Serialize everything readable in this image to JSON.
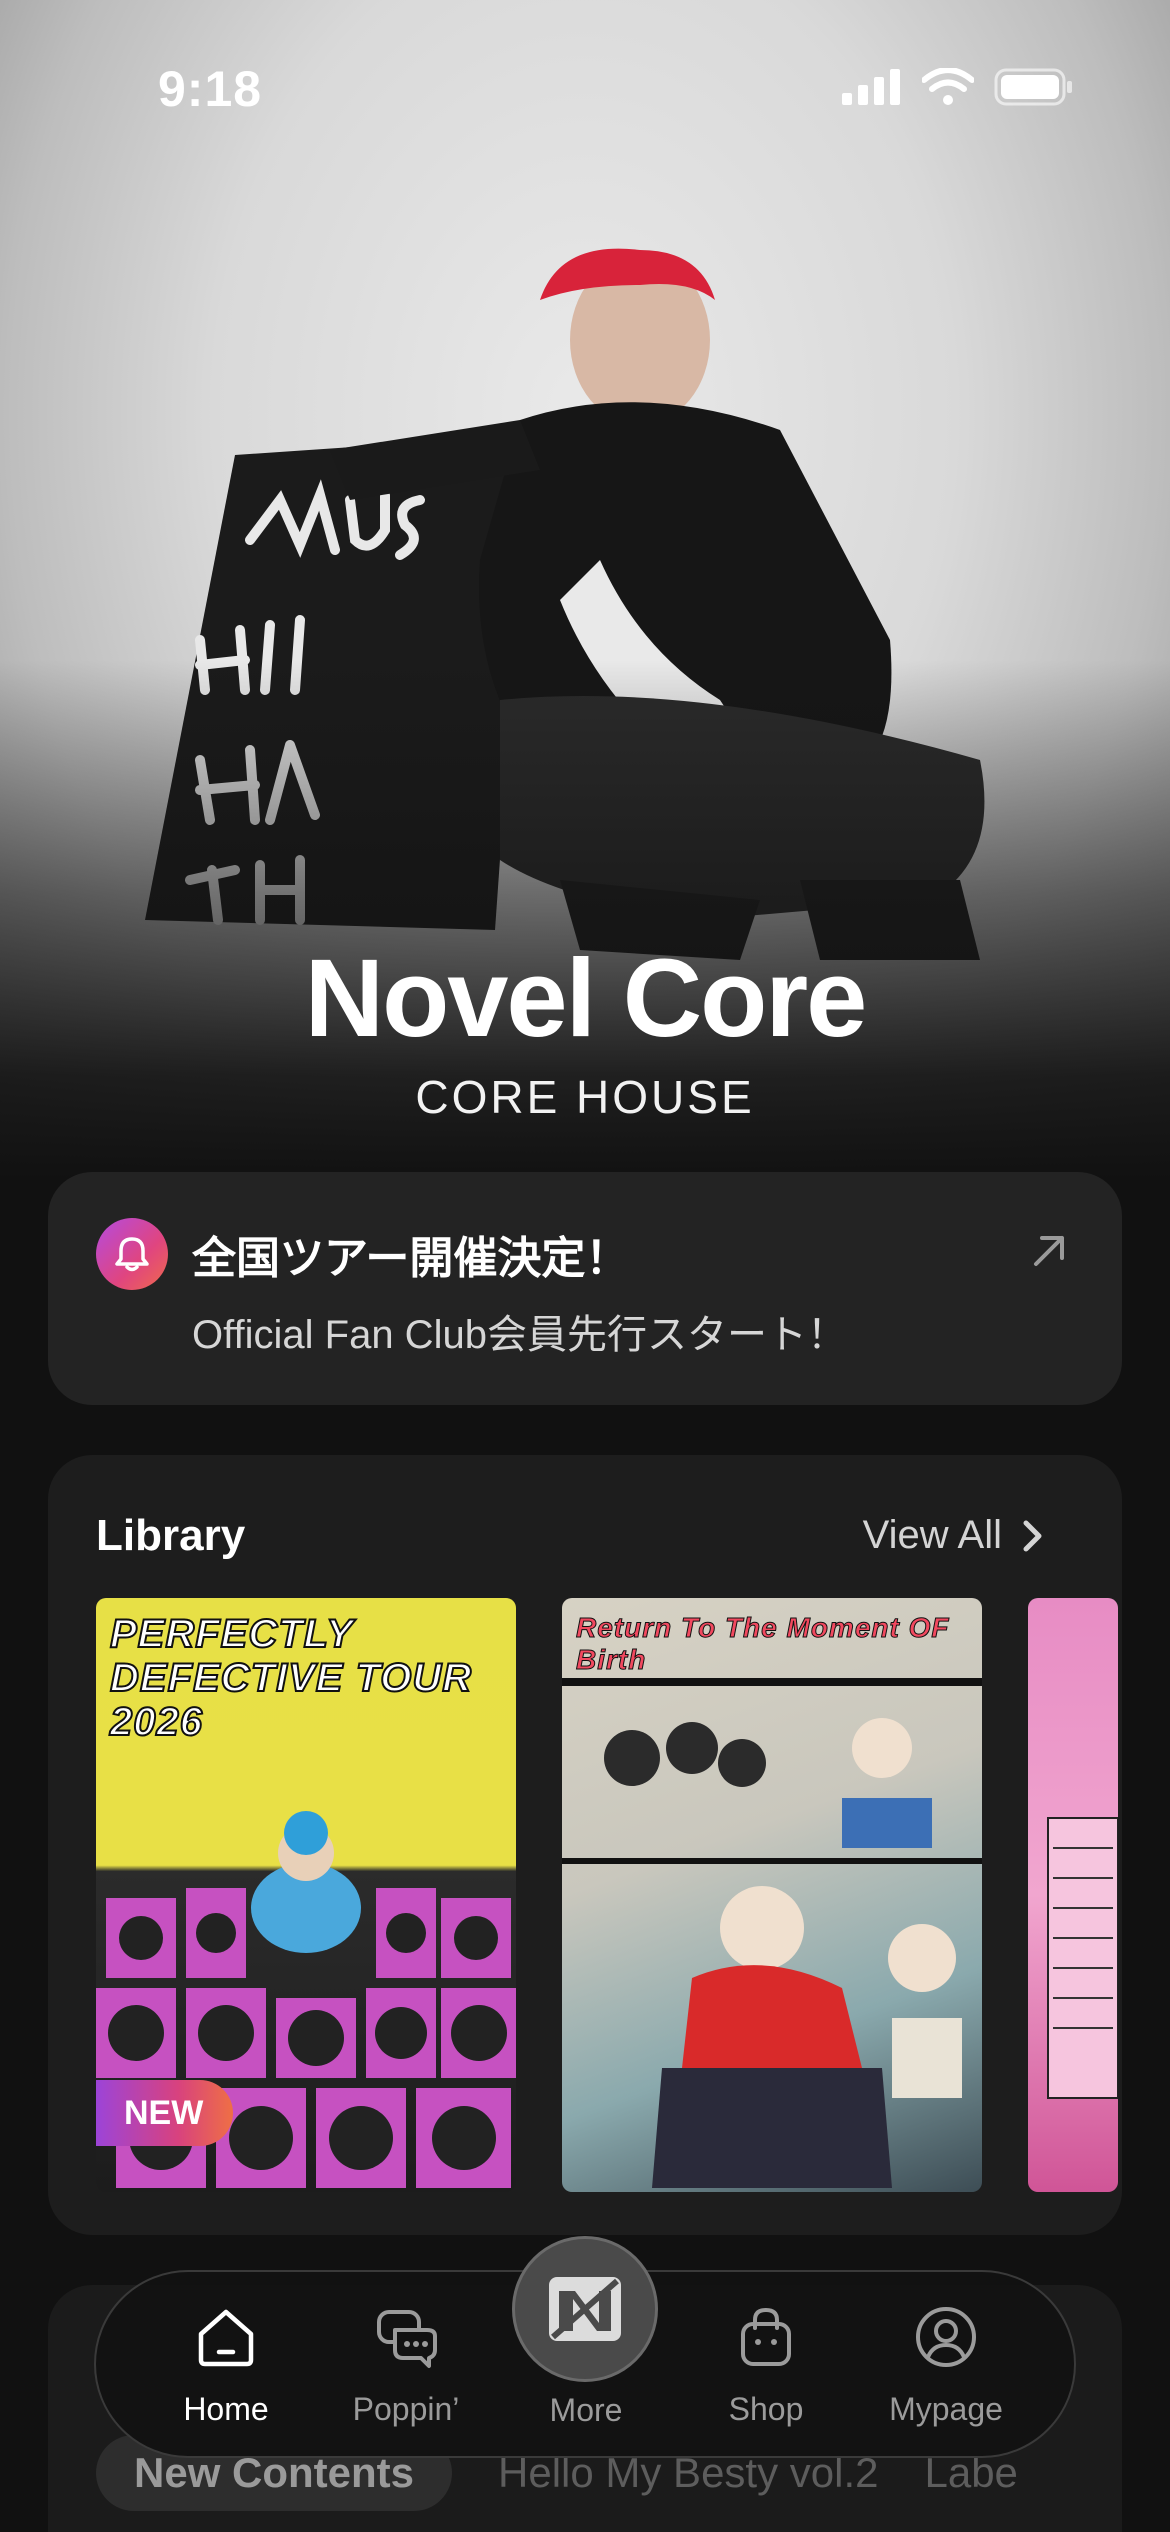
{
  "status_bar": {
    "time": "9:18"
  },
  "hero": {
    "artist_name": "Novel Core",
    "subtitle": "CORE HOUSE",
    "sign_text": "MUSIC HITS HARDER THAN"
  },
  "notice": {
    "title": "全国ツアー開催決定！",
    "body": "Official Fan Club会員先行スタート！"
  },
  "library": {
    "title": "Library",
    "view_all": "View All",
    "items": [
      {
        "cover_title": "PERFECTLY DEFECTIVE TOUR 2026",
        "badge": "NEW"
      },
      {
        "cover_title": "Return To The Moment OF Birth"
      },
      {
        "cover_title": ""
      }
    ]
  },
  "next_section": {
    "chips": [
      "New Contents",
      "Hello My Besty vol.2",
      "Labe"
    ]
  },
  "tab_bar": {
    "tabs": [
      {
        "label": "Home",
        "icon": "home-icon",
        "active": true
      },
      {
        "label": "Poppin’",
        "icon": "chat-bubbles-icon"
      },
      {
        "label": "More",
        "icon": "logo-icon"
      },
      {
        "label": "Shop",
        "icon": "shopping-bag-icon"
      },
      {
        "label": "Mypage",
        "icon": "user-circle-icon"
      }
    ]
  },
  "colors": {
    "background": "#111111",
    "card": "#232323",
    "accent_gradient_start": "#9c44d8",
    "accent_gradient_end": "#ef6f45"
  }
}
